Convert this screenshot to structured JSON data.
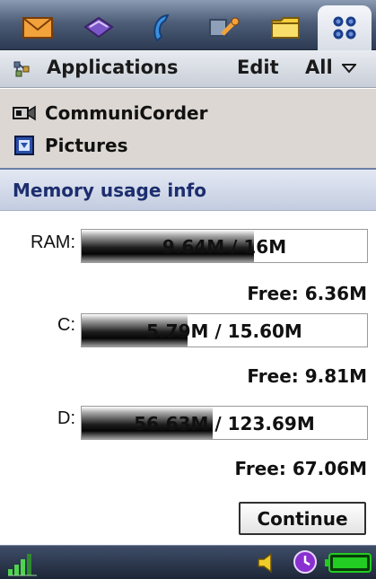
{
  "app_tabs": [
    {
      "name": "messaging-icon",
      "active": false
    },
    {
      "name": "contacts-book-icon",
      "active": false
    },
    {
      "name": "phone-icon",
      "active": false
    },
    {
      "name": "tools-icon",
      "active": false
    },
    {
      "name": "folder-icon",
      "active": false
    },
    {
      "name": "applications-grid-icon",
      "active": true
    }
  ],
  "menubar": {
    "icon": "hierarchy-icon",
    "applications_label": "Applications",
    "edit_label": "Edit",
    "filter_label": "All"
  },
  "background_list": [
    {
      "icon": "video-camera-icon",
      "label": "CommuniCorder"
    },
    {
      "icon": "pictures-icon",
      "label": "Pictures"
    }
  ],
  "dialog": {
    "title": "Memory usage info",
    "rows": [
      {
        "label": "RAM:",
        "used": 9.64,
        "total": 16,
        "bar_text": "9.64M / 16M",
        "free_text": "Free: 6.36M"
      },
      {
        "label": "C:",
        "used": 5.79,
        "total": 15.6,
        "bar_text": "5.79M / 15.60M",
        "free_text": "Free: 9.81M"
      },
      {
        "label": "D:",
        "used": 56.63,
        "total": 123.69,
        "bar_text": "56.63M / 123.69M",
        "free_text": "Free: 67.06M"
      }
    ],
    "continue_label": "Continue"
  },
  "statusbar": {
    "icons": [
      "signal-strength-icon",
      "speaker-icon",
      "clock-icon",
      "battery-icon"
    ]
  },
  "colors": {
    "title_text": "#1c2e6e",
    "bar_fill_dark": "#050505",
    "battery_green": "#22cc22"
  }
}
